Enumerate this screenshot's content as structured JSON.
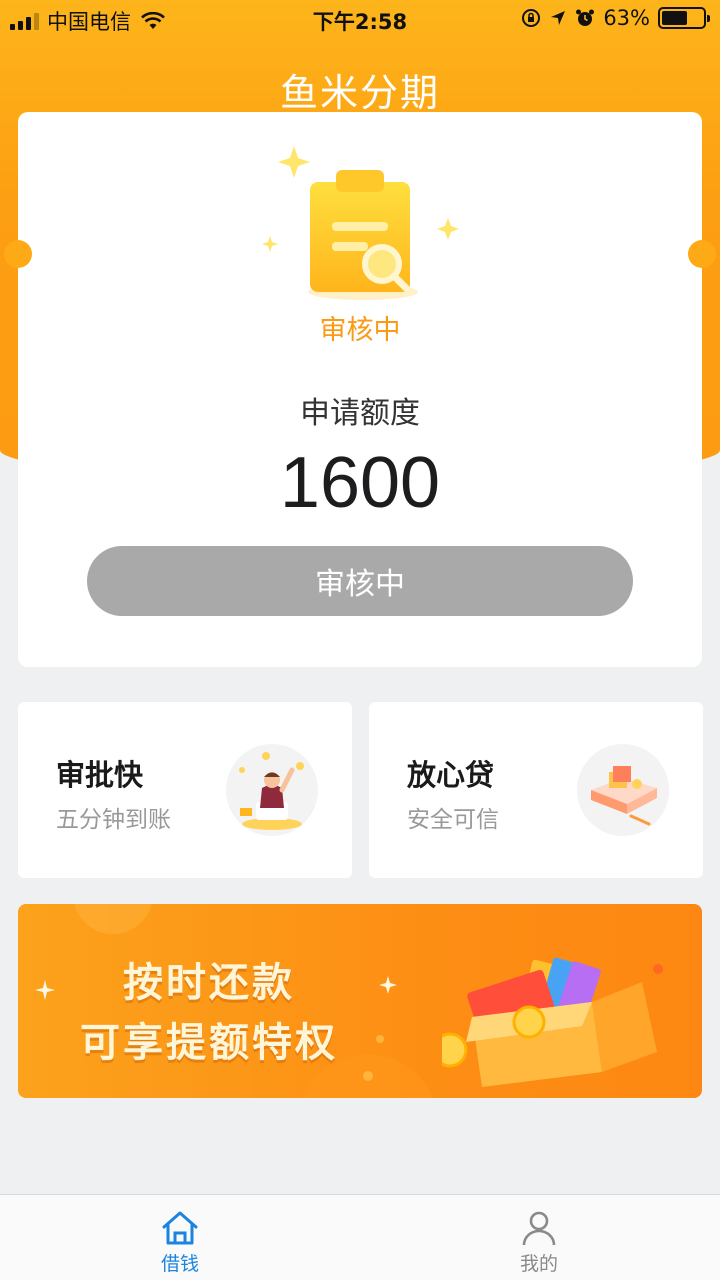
{
  "status_bar": {
    "carrier": "中国电信",
    "time": "下午2:58",
    "battery": "63%",
    "battery_level": 0.63
  },
  "app": {
    "title": "鱼米分期"
  },
  "review_card": {
    "status": "审核中",
    "amount_label": "申请额度",
    "amount": "1600",
    "button_label": "审核中"
  },
  "features": [
    {
      "title": "审批快",
      "subtitle": "五分钟到账",
      "icon": "person-celebrating-icon"
    },
    {
      "title": "放心贷",
      "subtitle": "安全可信",
      "icon": "book-icon"
    }
  ],
  "banner": {
    "line1": "按时还款",
    "line2": "可享提额特权"
  },
  "tab_bar": {
    "items": [
      {
        "label": "借钱",
        "icon": "home-icon",
        "active": true
      },
      {
        "label": "我的",
        "icon": "person-icon",
        "active": false
      }
    ]
  },
  "colors": {
    "brand_orange": "#fd9f12",
    "status_orange": "#fb9a16",
    "active_tab_blue": "#1a84e0",
    "disabled_button": "#a9a9a9"
  }
}
